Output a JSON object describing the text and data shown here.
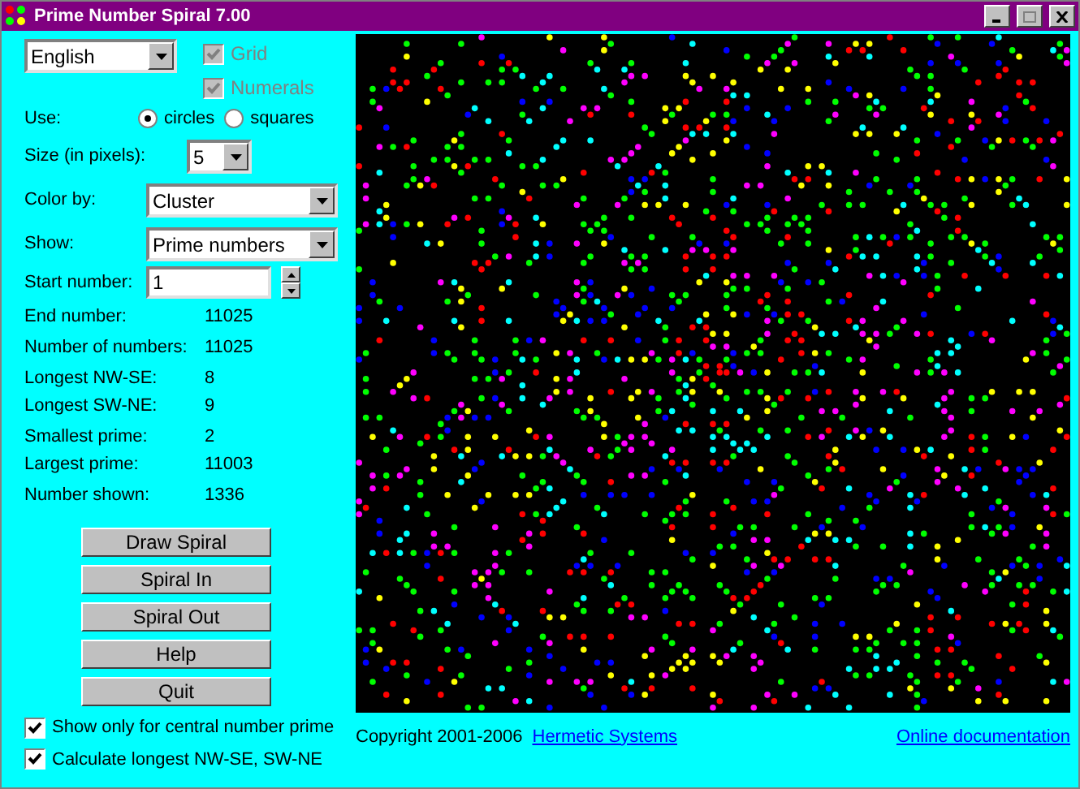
{
  "window": {
    "title": "Prime Number Spiral 7.00"
  },
  "language": {
    "value": "English"
  },
  "display_options": [
    {
      "label": "Grid",
      "checked": true,
      "disabled": true
    },
    {
      "label": "Numerals",
      "checked": true,
      "disabled": true
    }
  ],
  "use": {
    "label": "Use:",
    "options": [
      {
        "label": "circles",
        "selected": true
      },
      {
        "label": "squares",
        "selected": false
      }
    ]
  },
  "size": {
    "label": "Size (in pixels):",
    "value": "5"
  },
  "color_by": {
    "label": "Color by:",
    "value": "Cluster"
  },
  "show": {
    "label": "Show:",
    "value": "Prime numbers"
  },
  "start": {
    "label": "Start number:",
    "value": "1"
  },
  "stats": [
    {
      "label": "End number:",
      "value": "11025"
    },
    {
      "label": "Number of numbers:",
      "value": "11025"
    },
    {
      "label": "Longest NW-SE:",
      "value": "8"
    },
    {
      "label": "Longest SW-NE:",
      "value": "9"
    },
    {
      "label": "Smallest prime:",
      "value": "2"
    },
    {
      "label": "Largest prime:",
      "value": "11003"
    },
    {
      "label": "Number shown:",
      "value": "1336"
    }
  ],
  "buttons": [
    "Draw Spiral",
    "Spiral In",
    "Spiral Out",
    "Help",
    "Quit"
  ],
  "checkboxes": [
    {
      "label": "Show only for central number prime",
      "checked": true
    },
    {
      "label": "Calculate longest NW-SE, SW-NE",
      "checked": true
    }
  ],
  "footer": {
    "copyright": "Copyright 2001-2006",
    "link": "Hermetic Systems",
    "docs": "Online documentation"
  }
}
